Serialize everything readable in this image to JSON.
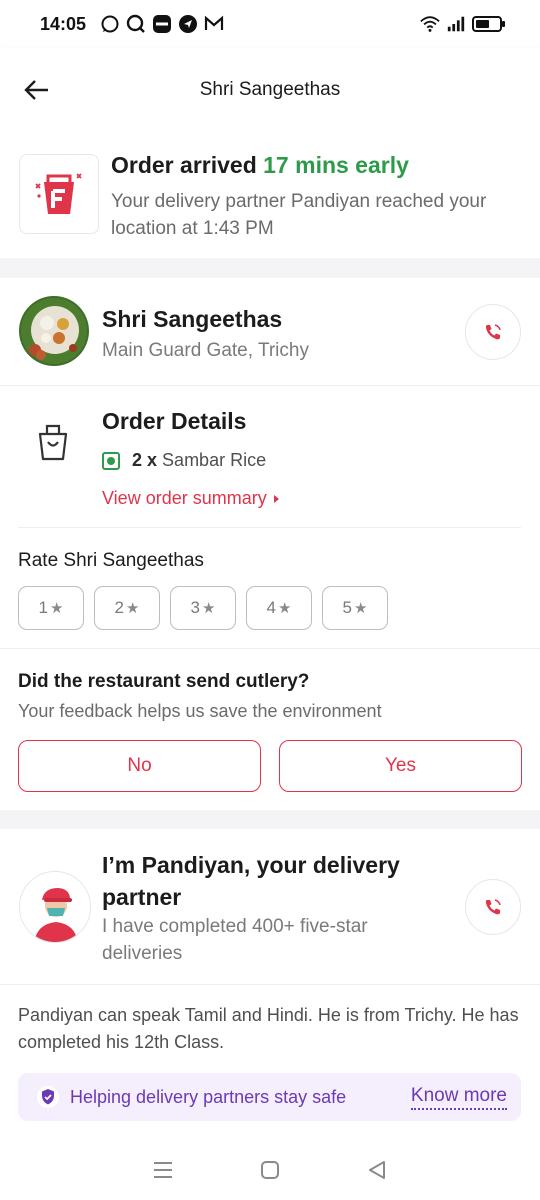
{
  "status_bar": {
    "time": "14:05",
    "left_icons": [
      "whatsapp-icon",
      "search-app-icon",
      "minus-app-icon",
      "location-app-icon",
      "gmail-icon"
    ],
    "right_icons": [
      "wifi-icon",
      "signal-icon",
      "battery-icon"
    ]
  },
  "header": {
    "title": "Shri Sangeethas",
    "back_icon": "back-arrow-icon"
  },
  "arrival": {
    "title_prefix": "Order arrived ",
    "title_highlight": "17 mins early",
    "subtitle": "Your delivery partner Pandiyan reached your location at 1:43 PM",
    "highlight_color": "#2e9b4a"
  },
  "restaurant": {
    "name": "Shri Sangeethas",
    "location": "Main Guard Gate, Trichy",
    "call_icon": "phone-icon"
  },
  "order": {
    "title": "Order Details",
    "quantity": "2 x",
    "item": "Sambar Rice",
    "summary_link": "View order summary",
    "link_color": "#e0344a"
  },
  "rating": {
    "label": "Rate Shri Sangeethas",
    "options": [
      "1",
      "2",
      "3",
      "4",
      "5"
    ]
  },
  "cutlery": {
    "question": "Did the restaurant send cutlery?",
    "subtitle": "Your feedback helps us save the environment",
    "no_label": "No",
    "yes_label": "Yes"
  },
  "partner": {
    "title": "I’m Pandiyan, your delivery partner",
    "subtitle": "I have completed 400+ five-star deliveries",
    "bio": "Pandiyan can speak Tamil and Hindi. He is from Trichy. He has completed his 12th Class."
  },
  "safety": {
    "text": "Helping delivery partners stay safe",
    "link": "Know more",
    "color": "#6a3bb4"
  },
  "navbar": {
    "icons": [
      "menu-icon",
      "home-square-icon",
      "back-triangle-icon"
    ]
  }
}
